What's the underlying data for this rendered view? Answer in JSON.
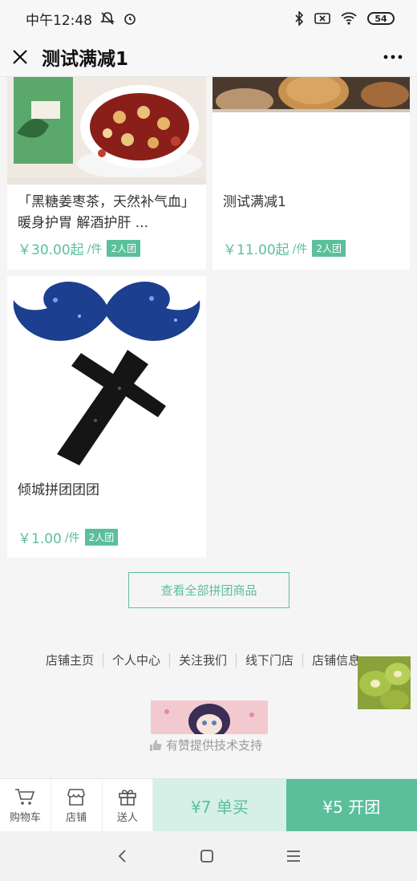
{
  "status_bar": {
    "time": "中午12:48",
    "battery": "54"
  },
  "nav": {
    "title": "测试满减1"
  },
  "products": [
    {
      "name": "「黑糖姜枣茶，天然补气血」暖身护胃 解酒护肝 ...",
      "price": "￥30.00起",
      "unit": "/件",
      "badge": "2人团"
    },
    {
      "name": "测试满减1",
      "price": "￥11.00起",
      "unit": "/件",
      "badge": "2人团"
    },
    {
      "name": "倾城拼团团团",
      "price": "￥1.00",
      "unit": "/件",
      "badge": "2人团"
    }
  ],
  "view_all": "查看全部拼团商品",
  "footer_links": [
    "店铺主页",
    "个人中心",
    "关注我们",
    "线下门店",
    "店铺信息"
  ],
  "support_text": "有赞提供技术支持",
  "bottom_bar": {
    "cart": "购物车",
    "shop": "店铺",
    "gift": "送人",
    "single_buy": "¥7 单买",
    "group_buy": "¥5 开团"
  },
  "colors": {
    "accent": "#5bbf9b",
    "accent_light": "#d6f0e7"
  },
  "icons": [
    "close-icon",
    "more-icon",
    "cart-icon",
    "shop-icon",
    "gift-icon",
    "thumb-up-icon",
    "back-icon",
    "home-icon",
    "menu-icon",
    "bluetooth-icon",
    "wifi-icon"
  ]
}
